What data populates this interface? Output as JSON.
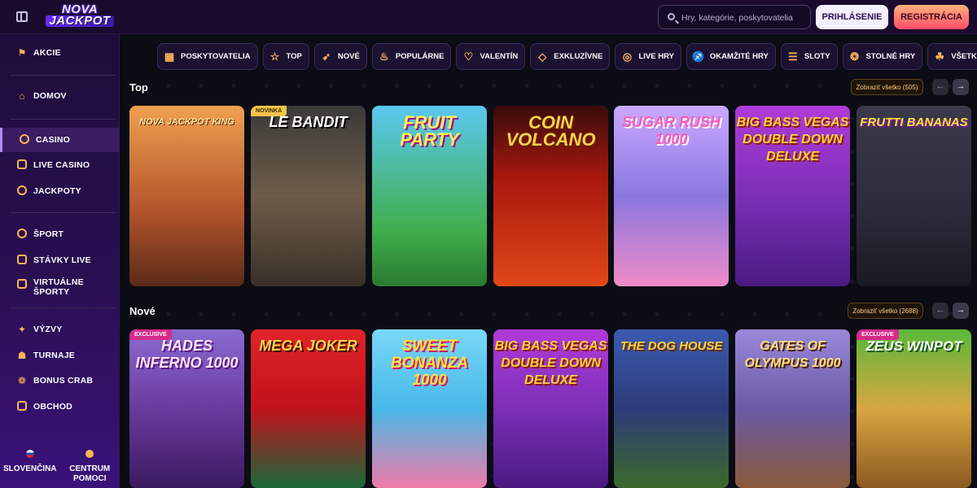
{
  "header": {
    "logo_line1": "NOVA",
    "logo_line2": "JACKPOT",
    "search_placeholder": "Hry, kategórie, poskytovatelia",
    "login_label": "PRIHLÁSENIE",
    "register_label": "REGISTRÁCIA",
    "accent": "#ffb45a"
  },
  "sidebar": {
    "items": [
      {
        "label": "AKCIE",
        "icon": "megaphone-icon"
      },
      {
        "label": "DOMOV",
        "icon": "home-icon"
      },
      {
        "label": "CASINO",
        "icon": "casino-chip-icon"
      },
      {
        "label": "LIVE CASINO",
        "icon": "live-icon"
      },
      {
        "label": "JACKPOTY",
        "icon": "jackpot-icon"
      },
      {
        "label": "ŠPORT",
        "icon": "ball-icon"
      },
      {
        "label": "STÁVKY LIVE",
        "icon": "play-icon"
      },
      {
        "label": "VIRTUÁLNE ŠPORTY",
        "icon": "virtual-sports-icon"
      },
      {
        "label": "VÝZVY",
        "icon": "challenge-icon"
      },
      {
        "label": "TURNAJE",
        "icon": "trophy-icon"
      },
      {
        "label": "BONUS CRAB",
        "icon": "crab-icon"
      },
      {
        "label": "OBCHOD",
        "icon": "shop-icon"
      }
    ],
    "language_label": "SLOVENČINA",
    "help_label": "CENTRUM POMOCI"
  },
  "categories": [
    {
      "label": "POSKYTOVATELIA",
      "icon": "providers-icon"
    },
    {
      "label": "TOP",
      "icon": "medal-icon"
    },
    {
      "label": "NOVÉ",
      "icon": "rocket-icon"
    },
    {
      "label": "POPULÁRNE",
      "icon": "flame-icon"
    },
    {
      "label": "VALENTÍN",
      "icon": "heart-icon"
    },
    {
      "label": "EXKLUZÍVNE",
      "icon": "diamond-icon"
    },
    {
      "label": "LIVE HRY",
      "icon": "live-icon"
    },
    {
      "label": "OKAMŽITÉ HRY",
      "icon": "instant-icon"
    },
    {
      "label": "SLOTY",
      "icon": "slot-icon"
    },
    {
      "label": "STOLNÉ HRY",
      "icon": "table-games-icon"
    },
    {
      "label": "VŠETKY HRY",
      "icon": "cherry-icon"
    }
  ],
  "sections": {
    "top": {
      "title": "Top",
      "view_all": "Zobraziť všetko (505)",
      "games": [
        {
          "title": "NOVA JACKPOT KING",
          "tag": "",
          "bg": "#b0522a"
        },
        {
          "title": "LE BANDIT",
          "tag": "NOVINKA",
          "bg": "#6e5c48"
        },
        {
          "title": "FRUIT PARTY",
          "tag": "",
          "bg": "#3fae4a"
        },
        {
          "title": "COIN VOLCANO",
          "tag": "",
          "bg": "#a8180e"
        },
        {
          "title": "SUGAR RUSH 1000",
          "tag": "",
          "bg": "#8a78e0"
        },
        {
          "title": "BIG BASS VEGAS DOUBLE DOWN DELUXE",
          "tag": "",
          "bg": "#7b2fb8"
        },
        {
          "title": "FRUTTI BANANAS",
          "tag": "",
          "bg": "#2a2a3a"
        }
      ]
    },
    "new": {
      "title": "Nové",
      "view_all": "Zobraziť všetko (2688)",
      "games": [
        {
          "title": "HADES INFERNO 1000",
          "tag": "EXCLUSIVE",
          "bg": "#6a3b9e"
        },
        {
          "title": "MEGA JOKER",
          "tag": "",
          "bg": "#c0121a"
        },
        {
          "title": "SWEET BONANZA 1000",
          "tag": "",
          "bg": "#47b8e8"
        },
        {
          "title": "BIG BASS VEGAS DOUBLE DOWN DELUXE",
          "tag": "",
          "bg": "#7b2fb8"
        },
        {
          "title": "THE DOG HOUSE",
          "tag": "",
          "bg": "#2d3c7a"
        },
        {
          "title": "GATES OF OLYMPUS 1000",
          "tag": "",
          "bg": "#6a5aa8"
        },
        {
          "title": "ZEUS WINPOT",
          "tag": "EXCLUSIVE",
          "bg": "#d8a640"
        }
      ]
    }
  }
}
